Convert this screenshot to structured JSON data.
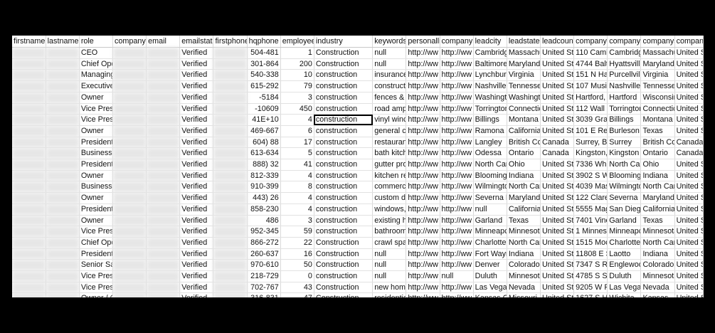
{
  "columns": [
    "firstname",
    "lastname",
    "role",
    "company",
    "email",
    "emailstatus",
    "firstphone",
    "hqphone",
    "employees",
    "industry",
    "keywords",
    "personallinkedin",
    "companylinkedin",
    "leadcity",
    "leadstate",
    "leadcountry",
    "companyaddress",
    "companycity",
    "companystate",
    "companycountry"
  ],
  "rows": [
    {
      "role": "CEO",
      "emailstatus": "Verified",
      "hqphone": "504-481",
      "employees": "1",
      "industry": "Construction",
      "keywords": "null",
      "personal": "http://ww",
      "company_li": "http://ww",
      "leadcity": "Cambridge",
      "leadstate": "Massachu",
      "leadcountry": "United Sta",
      "address": "110 Cambr",
      "ccity": "Cambridge",
      "cstate": "Massachu",
      "ccountry": "United S"
    },
    {
      "role": "Chief Ope",
      "emailstatus": "Verified",
      "hqphone": "301-864",
      "employees": "200",
      "industry": "Construction",
      "keywords": "null",
      "personal": "http://ww",
      "company_li": "http://ww",
      "leadcity": "Baltimore",
      "leadstate": "Maryland",
      "leadcountry": "United Sta",
      "address": "4744 Balti",
      "ccity": "Hyattsville",
      "cstate": "Maryland",
      "ccountry": "United S"
    },
    {
      "role": "Managing",
      "emailstatus": "Verified",
      "hqphone": "540-338",
      "employees": "10",
      "industry": "construction",
      "keywords": "insurance",
      "personal": "http://ww",
      "company_li": "http://ww",
      "leadcity": "Lynchburg",
      "leadstate": "Virginia",
      "leadcountry": "United Sta",
      "address": "151 N Hat",
      "ccity": "Purcellvill",
      "cstate": "Virginia",
      "ccountry": "United S"
    },
    {
      "role": "Executive",
      "emailstatus": "Verified",
      "hqphone": "615-292",
      "employees": "79",
      "industry": "construction",
      "keywords": "constructi",
      "personal": "http://ww",
      "company_li": "http://ww",
      "leadcity": "Nashville",
      "leadstate": "Tennesse",
      "leadcountry": "United Sta",
      "address": "107 Music",
      "ccity": "Nashville",
      "cstate": "Tennesse",
      "ccountry": "United S"
    },
    {
      "role": "Owner",
      "emailstatus": "Verified",
      "hqphone": "-5184",
      "employees": "3",
      "industry": "construction",
      "keywords": "fences & g",
      "personal": "http://ww",
      "company_li": "http://ww",
      "leadcity": "Washingto",
      "leadstate": "Washingto",
      "leadcountry": "United Sta",
      "address": "Hartford, '",
      "ccity": "Hartford",
      "cstate": "Wisconsin",
      "ccountry": "United S"
    },
    {
      "role": "Vice Presi",
      "emailstatus": "Verified",
      "hqphone": "-10609",
      "employees": "450",
      "industry": "construction",
      "keywords": "road amp",
      "personal": "http://ww",
      "company_li": "http://ww",
      "leadcity": "Torrington",
      "leadstate": "Connectic",
      "leadcountry": "United Sta",
      "address": "112 Wall S",
      "ccity": "Torrington",
      "cstate": "Connectic",
      "ccountry": "United S"
    },
    {
      "role": "Vice Presi",
      "emailstatus": "Verified",
      "hqphone": "41E+10",
      "employees": "4",
      "industry": "construction",
      "keywords": "vinyl winc",
      "personal": "http://ww",
      "company_li": "http://ww",
      "leadcity": "Billings",
      "leadstate": "Montana",
      "leadcountry": "United Sta",
      "address": "3039 Gran",
      "ccity": "Billings",
      "cstate": "Montana",
      "ccountry": "United S"
    },
    {
      "role": "Owner",
      "emailstatus": "Verified",
      "hqphone": "469-667",
      "employees": "6",
      "industry": "construction",
      "keywords": "general cc",
      "personal": "http://ww",
      "company_li": "http://ww",
      "leadcity": "Ramona",
      "leadstate": "California",
      "leadcountry": "United Sta",
      "address": "101 E Renf",
      "ccity": "Burleson",
      "cstate": "Texas",
      "ccountry": "United S"
    },
    {
      "role": "President",
      "emailstatus": "Verified",
      "hqphone": "604) 88",
      "employees": "17",
      "industry": "construction",
      "keywords": "restaurant",
      "personal": "http://ww",
      "company_li": "http://ww",
      "leadcity": "Langley",
      "leadstate": "British Col",
      "leadcountry": "Canada",
      "address": "Surrey, Br",
      "ccity": "Surrey",
      "cstate": "British Col",
      "ccountry": "Canada"
    },
    {
      "role": "Business C",
      "emailstatus": "Verified",
      "hqphone": "613-634",
      "employees": "5",
      "industry": "construction",
      "keywords": "bath kitch",
      "personal": "http://ww",
      "company_li": "http://ww",
      "leadcity": "Odessa",
      "leadstate": "Ontario",
      "leadcountry": "Canada",
      "address": "Kingston,",
      "ccity": "Kingston",
      "cstate": "Ontario",
      "ccountry": "Canada"
    },
    {
      "role": "President",
      "emailstatus": "Verified",
      "hqphone": "888) 32",
      "employees": "41",
      "industry": "construction",
      "keywords": "gutter pro",
      "personal": "http://ww",
      "company_li": "http://ww",
      "leadcity": "North Can",
      "leadstate": "Ohio",
      "leadcountry": "United Sta",
      "address": "7336 Whip",
      "ccity": "North Can",
      "cstate": "Ohio",
      "ccountry": "United S"
    },
    {
      "role": "Owner",
      "emailstatus": "Verified",
      "hqphone": "812-339",
      "employees": "4",
      "industry": "construction",
      "keywords": "kitchen re",
      "personal": "http://ww",
      "company_li": "http://ww",
      "leadcity": "Blooming",
      "leadstate": "Indiana",
      "leadcountry": "United Sta",
      "address": "3902 S Wa",
      "ccity": "Blooming",
      "cstate": "Indiana",
      "ccountry": "United S"
    },
    {
      "role": "Business C",
      "emailstatus": "Verified",
      "hqphone": "910-399",
      "employees": "8",
      "industry": "construction",
      "keywords": "commerci",
      "personal": "http://ww",
      "company_li": "http://ww",
      "leadcity": "Wilmingto",
      "leadstate": "North Car",
      "leadcountry": "United Sta",
      "address": "4039 Masc",
      "ccity": "Wilmingto",
      "cstate": "North Car",
      "ccountry": "United S"
    },
    {
      "role": "Owner",
      "emailstatus": "Verified",
      "hqphone": "443) 26",
      "employees": "4",
      "industry": "construction",
      "keywords": "custom de",
      "personal": "http://ww",
      "company_li": "http://ww",
      "leadcity": "Severna P",
      "leadstate": "Maryland",
      "leadcountry": "United Sta",
      "address": "122 Clarer",
      "ccity": "Severna P",
      "cstate": "Maryland",
      "ccountry": "United S"
    },
    {
      "role": "President",
      "emailstatus": "Verified",
      "hqphone": "858-230",
      "employees": "4",
      "industry": "construction",
      "keywords": "windows,",
      "personal": "http://ww",
      "company_li": "http://ww",
      "leadcity": "null",
      "leadstate": "California",
      "leadcountry": "United Sta",
      "address": "5555 Mag",
      "ccity": "San Diego",
      "cstate": "California",
      "ccountry": "United S"
    },
    {
      "role": "Owner",
      "emailstatus": "Verified",
      "hqphone": "486",
      "employees": "3",
      "industry": "construction",
      "keywords": "existing h",
      "personal": "http://ww",
      "company_li": "http://ww",
      "leadcity": "Garland",
      "leadstate": "Texas",
      "leadcountry": "United Sta",
      "address": "7401 Vine",
      "ccity": "Garland",
      "cstate": "Texas",
      "ccountry": "United S"
    },
    {
      "role": "Vice Presi",
      "emailstatus": "Verified",
      "hqphone": "952-345",
      "employees": "59",
      "industry": "construction",
      "keywords": "bathroom",
      "personal": "http://ww",
      "company_li": "http://ww",
      "leadcity": "Minneapc",
      "leadstate": "Minnesot",
      "leadcountry": "United Sta",
      "address": "1 Minnesot",
      "ccity": "Minneapc",
      "cstate": "Minnesota",
      "ccountry": "United S"
    },
    {
      "role": "Chief Ope",
      "emailstatus": "Verified",
      "hqphone": "866-272",
      "employees": "22",
      "industry": "Construction",
      "keywords": "crawl spac",
      "personal": "http://ww",
      "company_li": "http://ww",
      "leadcity": "Charlotte",
      "leadstate": "North Car",
      "leadcountry": "United Sta",
      "address": "1515 Mock",
      "ccity": "Charlotte",
      "cstate": "North Car",
      "ccountry": "United S"
    },
    {
      "role": "President",
      "emailstatus": "Verified",
      "hqphone": "260-637",
      "employees": "16",
      "industry": "Construction",
      "keywords": "null",
      "personal": "http://ww",
      "company_li": "http://ww",
      "leadcity": "Fort Wayn",
      "leadstate": "Indiana",
      "leadcountry": "United Sta",
      "address": "11808 E St",
      "ccity": "Laotto",
      "cstate": "Indiana",
      "ccountry": "United S"
    },
    {
      "role": "Senior Sal",
      "emailstatus": "Verified",
      "hqphone": "970-610",
      "employees": "50",
      "industry": "Construction",
      "keywords": "null",
      "personal": "http://ww",
      "company_li": "http://ww",
      "leadcity": "Denver",
      "leadstate": "Colorado",
      "leadcountry": "United Sta",
      "address": "7347 S Rev",
      "ccity": "Englewoo",
      "cstate": "Colorado",
      "ccountry": "United S"
    },
    {
      "role": "Vice Presi",
      "emailstatus": "Verified",
      "hqphone": "218-729",
      "employees": "0",
      "industry": "construction",
      "keywords": "null",
      "personal": "http://ww",
      "company_li": "null",
      "leadcity": "Duluth",
      "leadstate": "Minnesot",
      "leadcountry": "United Sta",
      "address": "4785 S Shc",
      "ccity": "Duluth",
      "cstate": "Minnesot",
      "ccountry": "United S"
    },
    {
      "role": "Vice Presi",
      "emailstatus": "Verified",
      "hqphone": "702-767",
      "employees": "43",
      "industry": "Construction",
      "keywords": "new home",
      "personal": "http://ww",
      "company_li": "http://ww",
      "leadcity": "Las Vegas",
      "leadstate": "Nevada",
      "leadcountry": "United Sta",
      "address": "9205 W Ru",
      "ccity": "Las Vegas",
      "cstate": "Nevada",
      "ccountry": "United S"
    },
    {
      "role": "Owner / G",
      "emailstatus": "Verified",
      "hqphone": "316-831",
      "employees": "47",
      "industry": "Construction",
      "keywords": "residentia",
      "personal": "http://ww",
      "company_li": "http://ww",
      "leadcity": "Kansas Cit",
      "leadstate": "Missouri",
      "leadcountry": "United Sta",
      "address": "1627 S Hill",
      "ccity": "Wichita",
      "cstate": "Kansas",
      "ccountry": "United S"
    },
    {
      "role": "Owner",
      "emailstatus": "Verified",
      "hqphone": "931-381",
      "employees": "17",
      "industry": "Construction",
      "keywords": "marble &",
      "personal": "http://ww",
      "company_li": "http://ww",
      "leadcity": "Columbia",
      "leadstate": "Tennesse",
      "leadcountry": "United Sta",
      "address": "2644 Pulas",
      "ccity": "Columbia",
      "cstate": "Tennesse",
      "ccountry": "United S"
    }
  ]
}
